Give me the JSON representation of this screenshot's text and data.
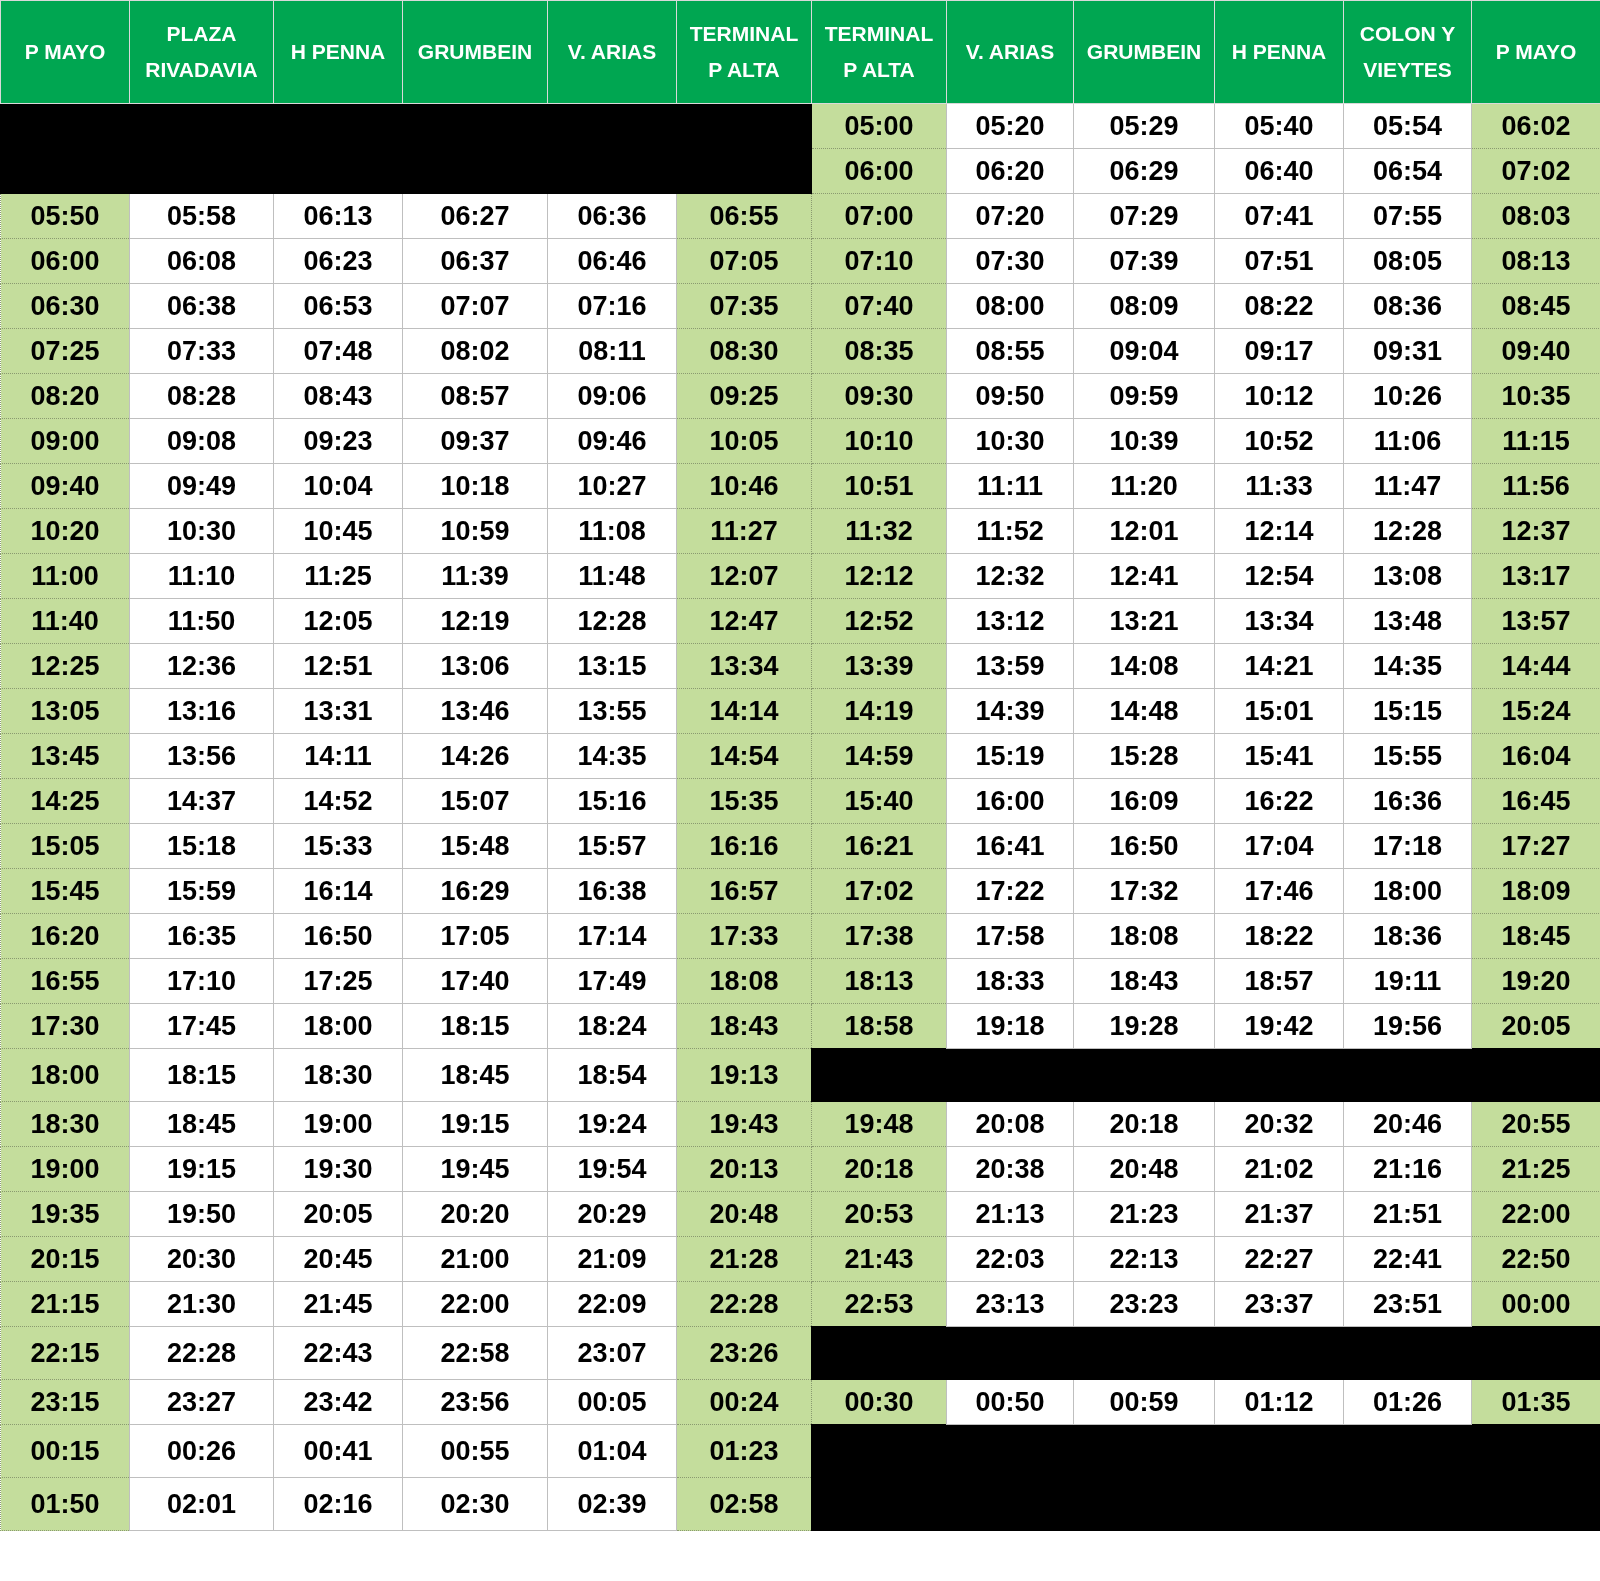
{
  "columns": [
    "P MAYO",
    "PLAZA RIVADAVIA",
    "H PENNA",
    "GRUMBEIN",
    "V. ARIAS",
    "TERMINAL P ALTA",
    "TERMINAL P ALTA",
    "V. ARIAS",
    "GRUMBEIN",
    "H PENNA",
    "COLON Y VIEYTES",
    "P MAYO"
  ],
  "rows": [
    {
      "outbound": null,
      "return": [
        "05:00",
        "05:20",
        "05:29",
        "05:40",
        "05:54",
        "06:02"
      ]
    },
    {
      "outbound": null,
      "return": [
        "06:00",
        "06:20",
        "06:29",
        "06:40",
        "06:54",
        "07:02"
      ]
    },
    {
      "outbound": [
        "05:50",
        "05:58",
        "06:13",
        "06:27",
        "06:36",
        "06:55"
      ],
      "return": [
        "07:00",
        "07:20",
        "07:29",
        "07:41",
        "07:55",
        "08:03"
      ]
    },
    {
      "outbound": [
        "06:00",
        "06:08",
        "06:23",
        "06:37",
        "06:46",
        "07:05"
      ],
      "return": [
        "07:10",
        "07:30",
        "07:39",
        "07:51",
        "08:05",
        "08:13"
      ]
    },
    {
      "outbound": [
        "06:30",
        "06:38",
        "06:53",
        "07:07",
        "07:16",
        "07:35"
      ],
      "return": [
        "07:40",
        "08:00",
        "08:09",
        "08:22",
        "08:36",
        "08:45"
      ]
    },
    {
      "outbound": [
        "07:25",
        "07:33",
        "07:48",
        "08:02",
        "08:11",
        "08:30"
      ],
      "return": [
        "08:35",
        "08:55",
        "09:04",
        "09:17",
        "09:31",
        "09:40"
      ]
    },
    {
      "outbound": [
        "08:20",
        "08:28",
        "08:43",
        "08:57",
        "09:06",
        "09:25"
      ],
      "return": [
        "09:30",
        "09:50",
        "09:59",
        "10:12",
        "10:26",
        "10:35"
      ]
    },
    {
      "outbound": [
        "09:00",
        "09:08",
        "09:23",
        "09:37",
        "09:46",
        "10:05"
      ],
      "return": [
        "10:10",
        "10:30",
        "10:39",
        "10:52",
        "11:06",
        "11:15"
      ]
    },
    {
      "outbound": [
        "09:40",
        "09:49",
        "10:04",
        "10:18",
        "10:27",
        "10:46"
      ],
      "return": [
        "10:51",
        "11:11",
        "11:20",
        "11:33",
        "11:47",
        "11:56"
      ]
    },
    {
      "outbound": [
        "10:20",
        "10:30",
        "10:45",
        "10:59",
        "11:08",
        "11:27"
      ],
      "return": [
        "11:32",
        "11:52",
        "12:01",
        "12:14",
        "12:28",
        "12:37"
      ]
    },
    {
      "outbound": [
        "11:00",
        "11:10",
        "11:25",
        "11:39",
        "11:48",
        "12:07"
      ],
      "return": [
        "12:12",
        "12:32",
        "12:41",
        "12:54",
        "13:08",
        "13:17"
      ]
    },
    {
      "outbound": [
        "11:40",
        "11:50",
        "12:05",
        "12:19",
        "12:28",
        "12:47"
      ],
      "return": [
        "12:52",
        "13:12",
        "13:21",
        "13:34",
        "13:48",
        "13:57"
      ]
    },
    {
      "outbound": [
        "12:25",
        "12:36",
        "12:51",
        "13:06",
        "13:15",
        "13:34"
      ],
      "return": [
        "13:39",
        "13:59",
        "14:08",
        "14:21",
        "14:35",
        "14:44"
      ]
    },
    {
      "outbound": [
        "13:05",
        "13:16",
        "13:31",
        "13:46",
        "13:55",
        "14:14"
      ],
      "return": [
        "14:19",
        "14:39",
        "14:48",
        "15:01",
        "15:15",
        "15:24"
      ]
    },
    {
      "outbound": [
        "13:45",
        "13:56",
        "14:11",
        "14:26",
        "14:35",
        "14:54"
      ],
      "return": [
        "14:59",
        "15:19",
        "15:28",
        "15:41",
        "15:55",
        "16:04"
      ]
    },
    {
      "outbound": [
        "14:25",
        "14:37",
        "14:52",
        "15:07",
        "15:16",
        "15:35"
      ],
      "return": [
        "15:40",
        "16:00",
        "16:09",
        "16:22",
        "16:36",
        "16:45"
      ]
    },
    {
      "outbound": [
        "15:05",
        "15:18",
        "15:33",
        "15:48",
        "15:57",
        "16:16"
      ],
      "return": [
        "16:21",
        "16:41",
        "16:50",
        "17:04",
        "17:18",
        "17:27"
      ]
    },
    {
      "outbound": [
        "15:45",
        "15:59",
        "16:14",
        "16:29",
        "16:38",
        "16:57"
      ],
      "return": [
        "17:02",
        "17:22",
        "17:32",
        "17:46",
        "18:00",
        "18:09"
      ]
    },
    {
      "outbound": [
        "16:20",
        "16:35",
        "16:50",
        "17:05",
        "17:14",
        "17:33"
      ],
      "return": [
        "17:38",
        "17:58",
        "18:08",
        "18:22",
        "18:36",
        "18:45"
      ]
    },
    {
      "outbound": [
        "16:55",
        "17:10",
        "17:25",
        "17:40",
        "17:49",
        "18:08"
      ],
      "return": [
        "18:13",
        "18:33",
        "18:43",
        "18:57",
        "19:11",
        "19:20"
      ]
    },
    {
      "outbound": [
        "17:30",
        "17:45",
        "18:00",
        "18:15",
        "18:24",
        "18:43"
      ],
      "return": [
        "18:58",
        "19:18",
        "19:28",
        "19:42",
        "19:56",
        "20:05"
      ]
    },
    {
      "outbound": [
        "18:00",
        "18:15",
        "18:30",
        "18:45",
        "18:54",
        "19:13"
      ],
      "return": null
    },
    {
      "outbound": [
        "18:30",
        "18:45",
        "19:00",
        "19:15",
        "19:24",
        "19:43"
      ],
      "return": [
        "19:48",
        "20:08",
        "20:18",
        "20:32",
        "20:46",
        "20:55"
      ]
    },
    {
      "outbound": [
        "19:00",
        "19:15",
        "19:30",
        "19:45",
        "19:54",
        "20:13"
      ],
      "return": [
        "20:18",
        "20:38",
        "20:48",
        "21:02",
        "21:16",
        "21:25"
      ]
    },
    {
      "outbound": [
        "19:35",
        "19:50",
        "20:05",
        "20:20",
        "20:29",
        "20:48"
      ],
      "return": [
        "20:53",
        "21:13",
        "21:23",
        "21:37",
        "21:51",
        "22:00"
      ]
    },
    {
      "outbound": [
        "20:15",
        "20:30",
        "20:45",
        "21:00",
        "21:09",
        "21:28"
      ],
      "return": [
        "21:43",
        "22:03",
        "22:13",
        "22:27",
        "22:41",
        "22:50"
      ]
    },
    {
      "outbound": [
        "21:15",
        "21:30",
        "21:45",
        "22:00",
        "22:09",
        "22:28"
      ],
      "return": [
        "22:53",
        "23:13",
        "23:23",
        "23:37",
        "23:51",
        "00:00"
      ]
    },
    {
      "outbound": [
        "22:15",
        "22:28",
        "22:43",
        "22:58",
        "23:07",
        "23:26"
      ],
      "return": null
    },
    {
      "outbound": [
        "23:15",
        "23:27",
        "23:42",
        "23:56",
        "00:05",
        "00:24"
      ],
      "return": [
        "00:30",
        "00:50",
        "00:59",
        "01:12",
        "01:26",
        "01:35"
      ]
    },
    {
      "outbound": [
        "00:15",
        "00:26",
        "00:41",
        "00:55",
        "01:04",
        "01:23"
      ],
      "return": null
    },
    {
      "outbound": [
        "01:50",
        "02:01",
        "02:16",
        "02:30",
        "02:39",
        "02:58"
      ],
      "return": null
    }
  ]
}
